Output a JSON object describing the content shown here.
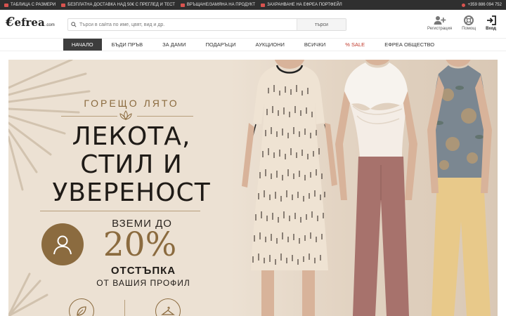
{
  "topbar": {
    "promos": [
      {
        "label": "ТАБЛИЦА С РАЗМЕРИ",
        "icon": "ruler-icon"
      },
      {
        "label": "БЕЗПЛАТНА ДОСТАВКА НАД 50€ С ПРЕГЛЕД И ТЕСТ",
        "icon": "truck-icon"
      },
      {
        "label": "ВРЪЩАНЕ/ЗАМЯНА НА ПРОДУКТ",
        "icon": "return-icon"
      },
      {
        "label": "ЗАХРАНВАНЕ НА ЕФРЕА ПОРТФЕЙЛ",
        "icon": "wallet-icon"
      }
    ],
    "phone": "+359 886 094 752"
  },
  "header": {
    "logo": {
      "mark": "€",
      "word": "efrea",
      "domain": ".com"
    },
    "search": {
      "placeholder": "Търси в сайта по име, цвят, вид и др.",
      "value": "",
      "button": "търси"
    },
    "icons": [
      {
        "label": "Регистрация",
        "icon": "user-plus-icon"
      },
      {
        "label": "Помощ",
        "icon": "lifebuoy-icon"
      },
      {
        "label": "Вход",
        "icon": "sign-in-icon"
      }
    ]
  },
  "nav": {
    "items": [
      {
        "label": "НАЧАЛО",
        "active": true
      },
      {
        "label": "БЪДИ ПРЪВ"
      },
      {
        "label": "ЗА ДАМИ"
      },
      {
        "label": "ПОДАРЪЦИ"
      },
      {
        "label": "АУКЦИОНИ"
      },
      {
        "label": "ВСИЧКИ"
      },
      {
        "label": "% SALE",
        "highlight": "#c0392b"
      },
      {
        "label": "ЕФРЕА ОБЩЕСТВО"
      }
    ]
  },
  "hero": {
    "kicker": "ГОРЕЩО ЛЯТО",
    "headline": [
      "ЛЕКОТА,",
      "СТИЛ И",
      "УВЕРЕНОСТ"
    ],
    "take": "ВЗЕМИ ДО",
    "percent": "20%",
    "offer": "ОТСТЪПКА",
    "profile": "ОТ ВАШИЯ ПРОФИЛ",
    "colors": {
      "accent": "#8b6b3f",
      "background": "#ece1d3",
      "text": "#1f1b17"
    }
  }
}
